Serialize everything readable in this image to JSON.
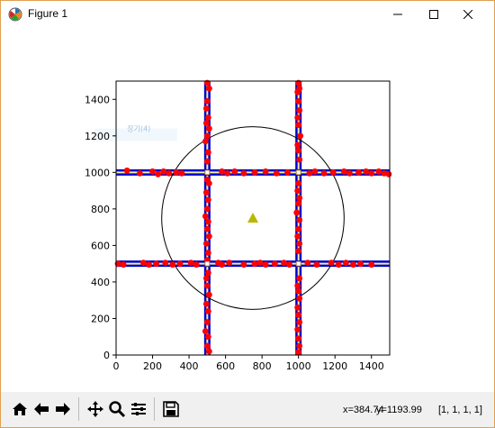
{
  "window": {
    "title": "Figure 1"
  },
  "window_controls": [
    "minimize-icon",
    "maximize-icon",
    "close-icon"
  ],
  "toolbar": {
    "buttons": [
      "home-icon",
      "back-icon",
      "forward-icon",
      "pan-icon",
      "zoom-icon",
      "configure-subplots-icon",
      "save-icon"
    ]
  },
  "status": {
    "x_readout": "x=384.74",
    "y_readout": "y=1193.99",
    "rgba_readout": "[1, 1, 1, 1]"
  },
  "chart_data": {
    "type": "scatter",
    "title": "",
    "xlabel": "",
    "ylabel": "",
    "xlim": [
      0,
      1500
    ],
    "ylim": [
      0,
      1500
    ],
    "xticks": [
      0,
      200,
      400,
      600,
      800,
      1000,
      1200,
      1400
    ],
    "yticks": [
      0,
      200,
      400,
      600,
      800,
      1000,
      1200,
      1400
    ],
    "grid": false,
    "legend_ghost_text": "장기(4)",
    "lines": [
      {
        "orientation": "vertical",
        "x": 500,
        "outer_color": "#0000cc",
        "inner_color": "#f0f0a0"
      },
      {
        "orientation": "vertical",
        "x": 1000,
        "outer_color": "#0000cc",
        "inner_color": "#f0f0a0"
      },
      {
        "orientation": "horizontal",
        "y": 500,
        "outer_color": "#0000cc",
        "inner_color": "#f0f0a0"
      },
      {
        "orientation": "horizontal",
        "y": 1000,
        "outer_color": "#0000cc",
        "inner_color": "#f0f0a0"
      }
    ],
    "circle": {
      "cx": 750,
      "cy": 750,
      "r": 500,
      "color": "#000000"
    },
    "triangle_marker": {
      "x": 750,
      "y": 750,
      "color": "#b8b800"
    },
    "intersection_markers": [
      {
        "x": 500,
        "y": 1000
      },
      {
        "x": 1000,
        "y": 1000
      },
      {
        "x": 500,
        "y": 500
      },
      {
        "x": 1000,
        "y": 500
      }
    ],
    "point_color": "#ff0000",
    "points": [
      {
        "x": 500,
        "y": 1490
      },
      {
        "x": 510,
        "y": 1460
      },
      {
        "x": 500,
        "y": 1390
      },
      {
        "x": 495,
        "y": 1350
      },
      {
        "x": 505,
        "y": 1300
      },
      {
        "x": 495,
        "y": 1270
      },
      {
        "x": 510,
        "y": 1240
      },
      {
        "x": 500,
        "y": 1200
      },
      {
        "x": 490,
        "y": 1170
      },
      {
        "x": 505,
        "y": 1110
      },
      {
        "x": 500,
        "y": 1060
      },
      {
        "x": 500,
        "y": 960
      },
      {
        "x": 510,
        "y": 940
      },
      {
        "x": 495,
        "y": 890
      },
      {
        "x": 505,
        "y": 850
      },
      {
        "x": 500,
        "y": 800
      },
      {
        "x": 490,
        "y": 760
      },
      {
        "x": 505,
        "y": 730
      },
      {
        "x": 500,
        "y": 690
      },
      {
        "x": 510,
        "y": 650
      },
      {
        "x": 495,
        "y": 610
      },
      {
        "x": 505,
        "y": 560
      },
      {
        "x": 500,
        "y": 520
      },
      {
        "x": 505,
        "y": 450
      },
      {
        "x": 495,
        "y": 420
      },
      {
        "x": 500,
        "y": 380
      },
      {
        "x": 510,
        "y": 330
      },
      {
        "x": 495,
        "y": 280
      },
      {
        "x": 505,
        "y": 240
      },
      {
        "x": 500,
        "y": 180
      },
      {
        "x": 490,
        "y": 130
      },
      {
        "x": 505,
        "y": 100
      },
      {
        "x": 500,
        "y": 50
      },
      {
        "x": 510,
        "y": 20
      },
      {
        "x": 1000,
        "y": 1490
      },
      {
        "x": 1005,
        "y": 1460
      },
      {
        "x": 995,
        "y": 1440
      },
      {
        "x": 1000,
        "y": 1390
      },
      {
        "x": 1005,
        "y": 1340
      },
      {
        "x": 995,
        "y": 1300
      },
      {
        "x": 1000,
        "y": 1260
      },
      {
        "x": 1010,
        "y": 1200
      },
      {
        "x": 995,
        "y": 1150
      },
      {
        "x": 1000,
        "y": 1120
      },
      {
        "x": 1005,
        "y": 1070
      },
      {
        "x": 1000,
        "y": 940
      },
      {
        "x": 995,
        "y": 900
      },
      {
        "x": 1005,
        "y": 860
      },
      {
        "x": 1000,
        "y": 830
      },
      {
        "x": 990,
        "y": 780
      },
      {
        "x": 1005,
        "y": 740
      },
      {
        "x": 1000,
        "y": 690
      },
      {
        "x": 995,
        "y": 650
      },
      {
        "x": 1005,
        "y": 610
      },
      {
        "x": 1000,
        "y": 570
      },
      {
        "x": 1005,
        "y": 420
      },
      {
        "x": 995,
        "y": 380
      },
      {
        "x": 1000,
        "y": 350
      },
      {
        "x": 1005,
        "y": 310
      },
      {
        "x": 995,
        "y": 260
      },
      {
        "x": 1000,
        "y": 220
      },
      {
        "x": 1005,
        "y": 180
      },
      {
        "x": 995,
        "y": 140
      },
      {
        "x": 1000,
        "y": 90
      },
      {
        "x": 1005,
        "y": 50
      },
      {
        "x": 1000,
        "y": 15
      },
      {
        "x": 60,
        "y": 1010
      },
      {
        "x": 130,
        "y": 995
      },
      {
        "x": 200,
        "y": 1005
      },
      {
        "x": 230,
        "y": 990
      },
      {
        "x": 260,
        "y": 1005
      },
      {
        "x": 290,
        "y": 995
      },
      {
        "x": 330,
        "y": 1000
      },
      {
        "x": 360,
        "y": 995
      },
      {
        "x": 580,
        "y": 1005
      },
      {
        "x": 610,
        "y": 995
      },
      {
        "x": 650,
        "y": 1005
      },
      {
        "x": 700,
        "y": 995
      },
      {
        "x": 760,
        "y": 1000
      },
      {
        "x": 820,
        "y": 1005
      },
      {
        "x": 880,
        "y": 995
      },
      {
        "x": 940,
        "y": 1000
      },
      {
        "x": 1060,
        "y": 995
      },
      {
        "x": 1090,
        "y": 1005
      },
      {
        "x": 1140,
        "y": 995
      },
      {
        "x": 1190,
        "y": 1000
      },
      {
        "x": 1250,
        "y": 1005
      },
      {
        "x": 1280,
        "y": 995
      },
      {
        "x": 1330,
        "y": 1000
      },
      {
        "x": 1370,
        "y": 1005
      },
      {
        "x": 1400,
        "y": 995
      },
      {
        "x": 1440,
        "y": 1005
      },
      {
        "x": 1470,
        "y": 995
      },
      {
        "x": 1495,
        "y": 990
      },
      {
        "x": 10,
        "y": 500
      },
      {
        "x": 40,
        "y": 495
      },
      {
        "x": 150,
        "y": 505
      },
      {
        "x": 180,
        "y": 495
      },
      {
        "x": 220,
        "y": 500
      },
      {
        "x": 270,
        "y": 505
      },
      {
        "x": 310,
        "y": 495
      },
      {
        "x": 350,
        "y": 500
      },
      {
        "x": 410,
        "y": 505
      },
      {
        "x": 440,
        "y": 495
      },
      {
        "x": 560,
        "y": 505
      },
      {
        "x": 580,
        "y": 495
      },
      {
        "x": 620,
        "y": 505
      },
      {
        "x": 700,
        "y": 495
      },
      {
        "x": 760,
        "y": 500
      },
      {
        "x": 790,
        "y": 505
      },
      {
        "x": 820,
        "y": 495
      },
      {
        "x": 870,
        "y": 500
      },
      {
        "x": 920,
        "y": 505
      },
      {
        "x": 950,
        "y": 495
      },
      {
        "x": 1050,
        "y": 505
      },
      {
        "x": 1100,
        "y": 495
      },
      {
        "x": 1180,
        "y": 505
      },
      {
        "x": 1220,
        "y": 495
      },
      {
        "x": 1260,
        "y": 505
      },
      {
        "x": 1300,
        "y": 495
      },
      {
        "x": 1340,
        "y": 500
      },
      {
        "x": 1400,
        "y": 495
      }
    ]
  }
}
